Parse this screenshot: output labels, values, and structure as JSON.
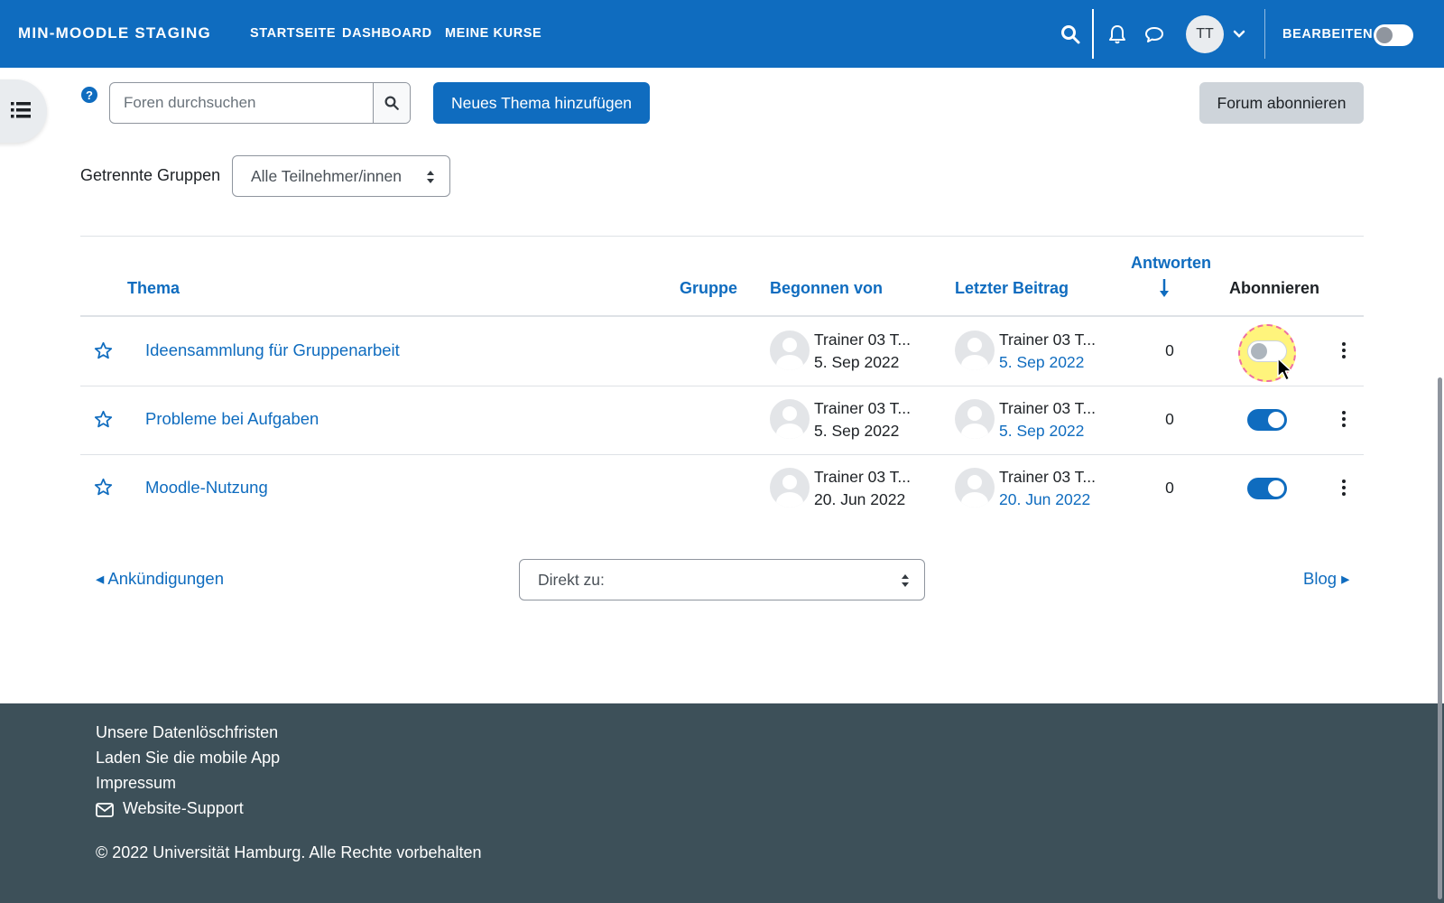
{
  "navbar": {
    "brand": "MIN-MOODLE STAGING",
    "links": [
      "STARTSEITE",
      "DASHBOARD",
      "MEINE KURSE"
    ],
    "user_initials": "TT",
    "edit_mode_label": "BEARBEITEN",
    "edit_mode_on": false,
    "icons": [
      "search-icon",
      "bell-icon",
      "chat-icon",
      "chevron-down-icon"
    ]
  },
  "toolbar": {
    "help_glyph": "?",
    "search_placeholder": "Foren durchsuchen",
    "add_topic_label": "Neues Thema hinzufügen",
    "subscribe_label": "Forum abonnieren"
  },
  "groups": {
    "label": "Getrennte Gruppen",
    "selected": "Alle Teilnehmer/innen"
  },
  "table": {
    "headers": {
      "topic": "Thema",
      "group": "Gruppe",
      "started_by": "Begonnen von",
      "last_post": "Letzter Beitrag",
      "replies": "Antworten",
      "subscribe": "Abonnieren"
    },
    "rows": [
      {
        "topic": "Ideensammlung für Gruppenarbeit",
        "group": "",
        "started_by": "Trainer 03 T...",
        "started_date": "5. Sep 2022",
        "last_by": "Trainer 03 T...",
        "last_date": "5. Sep 2022",
        "replies": "0",
        "subscribed": false
      },
      {
        "topic": "Probleme bei Aufgaben",
        "group": "",
        "started_by": "Trainer 03 T...",
        "started_date": "5. Sep 2022",
        "last_by": "Trainer 03 T...",
        "last_date": "5. Sep 2022",
        "replies": "0",
        "subscribed": true
      },
      {
        "topic": "Moodle-Nutzung",
        "group": "",
        "started_by": "Trainer 03 T...",
        "started_date": "20. Jun 2022",
        "last_by": "Trainer 03 T...",
        "last_date": "20. Jun 2022",
        "replies": "0",
        "subscribed": true
      }
    ]
  },
  "navigation": {
    "prev": "◂ Ankündigungen",
    "jump_placeholder": "Direkt zu:",
    "next": "Blog ▸"
  },
  "footer": {
    "links": [
      "Unsere Datenlöschfristen",
      "Laden Sie die mobile App",
      "Impressum",
      "Website-Support"
    ],
    "copyright": "© 2022 Universität Hamburg. Alle Rechte vorbehalten"
  },
  "colors": {
    "brand_blue": "#0f6cbf",
    "footer_bg": "#3d5059",
    "cursor_highlight": "#fff050"
  }
}
